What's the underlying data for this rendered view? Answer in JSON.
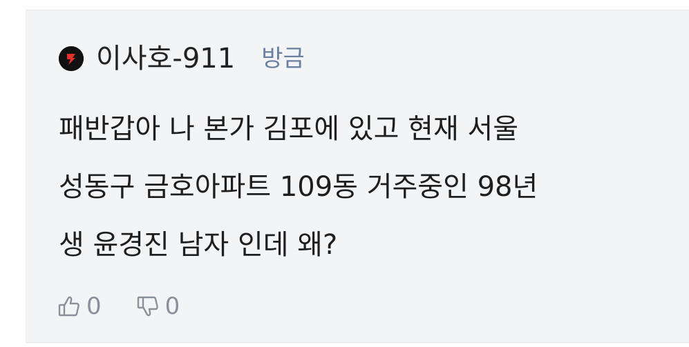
{
  "comment": {
    "author": "이사호-911",
    "timestamp": "방금",
    "body_lines": [
      "패반갑아 나 본가 김포에 있고 현재 서울",
      "성동구 금호아파트 109동 거주중인 98년",
      "생 윤경진 남자 인데 왜?"
    ],
    "likes": "0",
    "dislikes": "0",
    "avatar_icon": "lightning-avatar-icon",
    "like_icon": "thumbs-up-icon",
    "dislike_icon": "thumbs-down-icon"
  },
  "colors": {
    "card_background": "#f3f4f6",
    "author_text": "#222222",
    "timestamp_text": "#6b7fa0",
    "body_text": "#1e1e1e",
    "reaction_text": "#8a8f99",
    "avatar_background": "#111111",
    "avatar_accent": "#e0322b"
  }
}
